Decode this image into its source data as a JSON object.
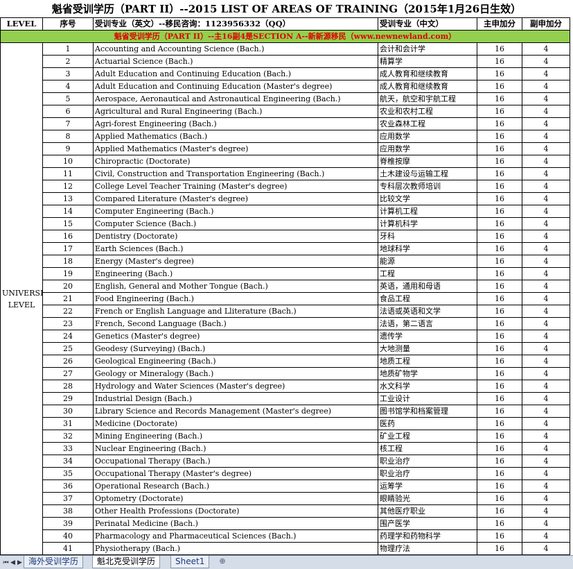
{
  "title": "魁省受训学历（PART II）--2015 LIST OF AREAS OF TRAINING（2015年1月26日生效）",
  "headers": {
    "level": "LEVEL",
    "seq": "序号",
    "en": "受训专业（英文）--移民咨询：1123956332（QQ）",
    "cn": "受训专业（中文）",
    "main": "主申加分",
    "sub": "副申加分"
  },
  "banner": "魁省受训学历（PART II）--主16副4是SECTION A--新新源移民（www.newnewland.com）",
  "level_label": "UNIVERSITY LEVEL",
  "rows": [
    {
      "n": "1",
      "en": "Accounting and Accounting Science (Bach.)",
      "cn": "会计和会计学",
      "m": "16",
      "s": "4"
    },
    {
      "n": "2",
      "en": "Actuarial Science (Bach.)",
      "cn": "精算学",
      "m": "16",
      "s": "4"
    },
    {
      "n": "3",
      "en": "Adult Education and Continuing Education (Bach.)",
      "cn": "成人教育和继续教育",
      "m": "16",
      "s": "4"
    },
    {
      "n": "4",
      "en": "Adult Education and Continuing Education (Master's degree)",
      "cn": "成人教育和继续教育",
      "m": "16",
      "s": "4"
    },
    {
      "n": "5",
      "en": "Aerospace, Aeronautical and Astronautical Engineering (Bach.)",
      "cn": "航天，航空和宇航工程",
      "m": "16",
      "s": "4"
    },
    {
      "n": "6",
      "en": "Agricultural and Rural Engineering (Bach.)",
      "cn": "农业和农村工程",
      "m": "16",
      "s": "4"
    },
    {
      "n": "7",
      "en": "Agri-forest Engineering (Bach.)",
      "cn": "农业森林工程",
      "m": "16",
      "s": "4"
    },
    {
      "n": "8",
      "en": "Applied Mathematics (Bach.)",
      "cn": "应用数学",
      "m": "16",
      "s": "4"
    },
    {
      "n": "9",
      "en": "Applied Mathematics (Master's degree)",
      "cn": "应用数学",
      "m": "16",
      "s": "4"
    },
    {
      "n": "10",
      "en": "Chiropractic (Doctorate)",
      "cn": "脊椎按摩",
      "m": "16",
      "s": "4"
    },
    {
      "n": "11",
      "en": "Civil, Construction and Transportation Engineering (Bach.)",
      "cn": "土木建设与运输工程",
      "m": "16",
      "s": "4"
    },
    {
      "n": "12",
      "en": "College Level Teacher Training (Master's degree)",
      "cn": "专科层次教师培训",
      "m": "16",
      "s": "4"
    },
    {
      "n": "13",
      "en": "Compared Literature (Master's degree)",
      "cn": "比较文学",
      "m": "16",
      "s": "4"
    },
    {
      "n": "14",
      "en": "Computer Engineering (Bach.)",
      "cn": "计算机工程",
      "m": "16",
      "s": "4"
    },
    {
      "n": "15",
      "en": "Computer Science (Bach.)",
      "cn": "计算机科学",
      "m": "16",
      "s": "4"
    },
    {
      "n": "16",
      "en": "Dentistry (Doctorate)",
      "cn": "牙科",
      "m": "16",
      "s": "4"
    },
    {
      "n": "17",
      "en": "Earth Sciences (Bach.)",
      "cn": "地球科学",
      "m": "16",
      "s": "4"
    },
    {
      "n": "18",
      "en": "Energy (Master's degree)",
      "cn": "能源",
      "m": "16",
      "s": "4"
    },
    {
      "n": "19",
      "en": "Engineering (Bach.)",
      "cn": "工程",
      "m": "16",
      "s": "4"
    },
    {
      "n": "20",
      "en": "English, General and Mother Tongue (Bach.)",
      "cn": "英语，通用和母语",
      "m": "16",
      "s": "4"
    },
    {
      "n": "21",
      "en": "Food Engineering (Bach.)",
      "cn": "食品工程",
      "m": "16",
      "s": "4"
    },
    {
      "n": "22",
      "en": "French or English Language and Lliterature (Bach.)",
      "cn": "法语或英语和文学",
      "m": "16",
      "s": "4"
    },
    {
      "n": "23",
      "en": "French, Second Language (Bach.)",
      "cn": "法语，第二语言",
      "m": "16",
      "s": "4"
    },
    {
      "n": "24",
      "en": "Genetics (Master's degree)",
      "cn": "遗传学",
      "m": "16",
      "s": "4"
    },
    {
      "n": "25",
      "en": "Geodesy (Surveying) (Bach.)",
      "cn": "大地测量",
      "m": "16",
      "s": "4"
    },
    {
      "n": "26",
      "en": "Geological Engineering (Bach.)",
      "cn": "地质工程",
      "m": "16",
      "s": "4"
    },
    {
      "n": "27",
      "en": "Geology or Mineralogy (Bach.)",
      "cn": "地质矿物学",
      "m": "16",
      "s": "4"
    },
    {
      "n": "28",
      "en": "Hydrology and Water Sciences (Master's degree)",
      "cn": "水文科学",
      "m": "16",
      "s": "4"
    },
    {
      "n": "29",
      "en": "Industrial Design (Bach.)",
      "cn": "工业设计",
      "m": "16",
      "s": "4"
    },
    {
      "n": "30",
      "en": "Library Science and Records Management (Master's degree)",
      "cn": "图书馆学和档案管理",
      "m": "16",
      "s": "4"
    },
    {
      "n": "31",
      "en": "Medicine (Doctorate)",
      "cn": "医药",
      "m": "16",
      "s": "4"
    },
    {
      "n": "32",
      "en": "Mining Engineering (Bach.)",
      "cn": "矿业工程",
      "m": "16",
      "s": "4"
    },
    {
      "n": "33",
      "en": "Nuclear Engineering (Bach.)",
      "cn": "核工程",
      "m": "16",
      "s": "4"
    },
    {
      "n": "34",
      "en": "Occupational Therapy (Bach.)",
      "cn": "职业治疗",
      "m": "16",
      "s": "4"
    },
    {
      "n": "35",
      "en": "Occupational Therapy (Master's degree)",
      "cn": "职业治疗",
      "m": "16",
      "s": "4"
    },
    {
      "n": "36",
      "en": "Operational Research (Bach.)",
      "cn": "运筹学",
      "m": "16",
      "s": "4"
    },
    {
      "n": "37",
      "en": "Optometry (Doctorate)",
      "cn": "眼睛验光",
      "m": "16",
      "s": "4"
    },
    {
      "n": "38",
      "en": "Other Health Professions (Doctorate)",
      "cn": "其他医疗职业",
      "m": "16",
      "s": "4"
    },
    {
      "n": "39",
      "en": "Perinatal Medicine (Bach.)",
      "cn": "围产医学",
      "m": "16",
      "s": "4"
    },
    {
      "n": "40",
      "en": "Pharmacology and Pharmaceutical Sciences (Bach.)",
      "cn": "药理学和药物科学",
      "m": "16",
      "s": "4"
    },
    {
      "n": "41",
      "en": "Physiotherapy (Bach.)",
      "cn": "物理疗法",
      "m": "16",
      "s": "4"
    }
  ],
  "sheet_tabs": [
    "海外受训学历",
    "魁北克受训学历",
    "Sheet1"
  ],
  "active_tab": 1
}
